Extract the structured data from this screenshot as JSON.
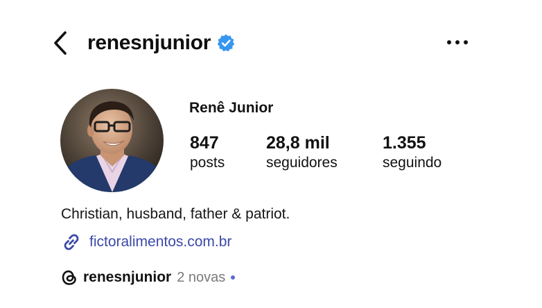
{
  "header": {
    "username": "renesnjunior",
    "verified": true
  },
  "profile": {
    "display_name": "Renê Junior",
    "stats": {
      "posts_count": "847",
      "posts_label": "posts",
      "followers_count": "28,8 mil",
      "followers_label": "seguidores",
      "following_count": "1.355",
      "following_label": "seguindo"
    },
    "bio": "Christian, husband, father & patriot.",
    "link": "fictoralimentos.com.br",
    "threads": {
      "handle": "renesnjunior",
      "new_label": "2 novas"
    }
  },
  "icons": {
    "back": "chevron-left-icon",
    "verified": "verified-badge-icon",
    "more": "more-horizontal-icon",
    "link": "link-icon",
    "threads": "threads-icon"
  },
  "colors": {
    "verified_blue": "#3797f0",
    "link_blue": "#3a48a8",
    "new_dot": "#5b6bd6"
  }
}
